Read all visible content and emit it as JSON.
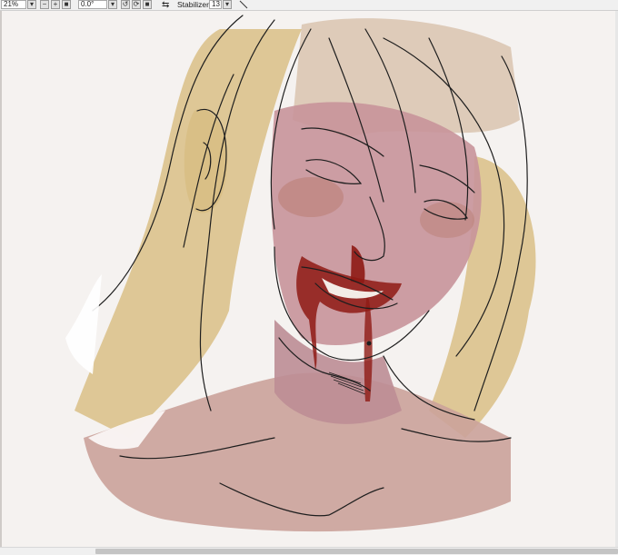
{
  "toolbar": {
    "zoom_value": "21%",
    "zoom_out_symbol": "−",
    "zoom_in_symbol": "+",
    "rotation_value": "0.0°",
    "stabilizer_label": "Stabilizer",
    "stabilizer_value": "13"
  },
  "icons": {
    "zoom_dropdown": "chevron-down-icon",
    "zoom_out": "minus-icon",
    "zoom_in": "plus-icon",
    "zoom_fit": "square-icon",
    "rotation_dropdown": "chevron-down-icon",
    "rotate_left": "rotate-left-icon",
    "rotate_reset": "rotate-reset-icon",
    "rotate_right": "square-icon",
    "flip": "flip-horizontal-icon",
    "stabilizer_dropdown": "chevron-down-icon",
    "pen": "pen-stroke-icon"
  },
  "colors": {
    "canvas_bg": "#f5f2f0",
    "hair": "#d9bf86",
    "skin": "#c8949a",
    "blush": "#b97c72",
    "blood": "#8e1a14",
    "line": "#1e1e1e"
  }
}
